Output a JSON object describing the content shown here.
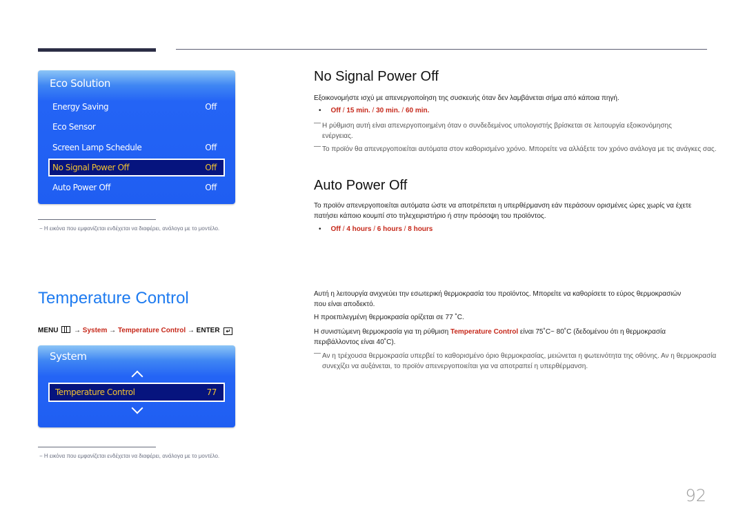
{
  "page_number": "92",
  "left": {
    "eco_panel": {
      "title": "Eco Solution",
      "items": [
        {
          "label": "Energy Saving",
          "value": "Off",
          "selected": false
        },
        {
          "label": "Eco Sensor",
          "value": "",
          "selected": false
        },
        {
          "label": "Screen Lamp Schedule",
          "value": "Off",
          "selected": false
        },
        {
          "label": "No Signal Power Off",
          "value": "Off",
          "selected": true
        },
        {
          "label": "Auto Power Off",
          "value": "Off",
          "selected": false
        }
      ]
    },
    "footnote_1": "− Η εικόνα που εμφανίζεται ενδέχεται να διαφέρει, ανάλογα με το μοντέλο.",
    "temperature_title": "Temperature Control",
    "menu_path": {
      "menu": "MENU",
      "arrow": "→",
      "system": "System",
      "temperature_control": "Temperature Control",
      "enter": "ENTER"
    },
    "system_panel": {
      "title": "System",
      "item_label": "Temperature Control",
      "item_value": "77"
    },
    "footnote_2": "− Η εικόνα που εμφανίζεται ενδέχεται να διαφέρει, ανάλογα με το μοντέλο."
  },
  "no_signal": {
    "title": "No Signal Power Off",
    "description": "Εξοικονομήστε ισχύ με απενεργοποίηση της συσκευής όταν δεν λαμβάνεται σήμα από κάποια πηγή.",
    "options": [
      "Off",
      "15 min.",
      "30 min.",
      "60 min."
    ],
    "notes": [
      "Η ρύθμιση αυτή είναι απενεργοποιημένη όταν ο συνδεδεμένος υπολογιστής βρίσκεται σε λειτουργία εξοικονόμησης ενέργειας.",
      "Το προϊόν θα απενεργοποιείται αυτόματα στον καθορισμένο χρόνο. Μπορείτε να αλλάξετε τον χρόνο ανάλογα με τις ανάγκες σας."
    ]
  },
  "auto_power": {
    "title": "Auto Power Off",
    "description": "Το προϊόν απενεργοποιείται αυτόματα ώστε να αποτρέπεται η υπερθέρμανση εάν περάσουν ορισμένες ώρες χωρίς να έχετε πατήσει κάποιο κουμπί στο τηλεχειριστήριο ή στην πρόσοψη του προϊόντος.",
    "options": [
      "Off",
      "4 hours",
      "6 hours",
      "8 hours"
    ]
  },
  "temperature": {
    "para1": "Αυτή η λειτουργία ανιχνεύει την εσωτερική θερμοκρασία του προϊόντος. Μπορείτε να καθορίσετε το εύρος θερμοκρασιών που είναι αποδεκτό.",
    "para2": "Η προεπιλεγμένη θερμοκρασία ορίζεται σε 77 ˚C.",
    "para3_before": "Η συνιστώμενη θερμοκρασία για τη ρύθμιση ",
    "para3_highlight": "Temperature Control",
    "para3_after": " είναι 75˚C~ 80˚C (δεδομένου ότι η θερμοκρασία περιβάλλοντος είναι 40˚C).",
    "note": "Αν η τρέχουσα θερμοκρασία υπερβεί το καθορισμένο όριο θερμοκρασίας, μειώνεται η φωτεινότητα της οθόνης. Αν η θερμοκρασία συνεχίζει να αυξάνεται, το προϊόν απενεργοποιείται για να αποτραπεί η υπερθέρμανση."
  },
  "colors": {
    "accent_red": "#c6281a",
    "title_blue": "#1e7bf0",
    "osd_blue": "#1f5ef2",
    "osd_selected_bg": "#06147e",
    "osd_selected_text": "#f4c230"
  }
}
